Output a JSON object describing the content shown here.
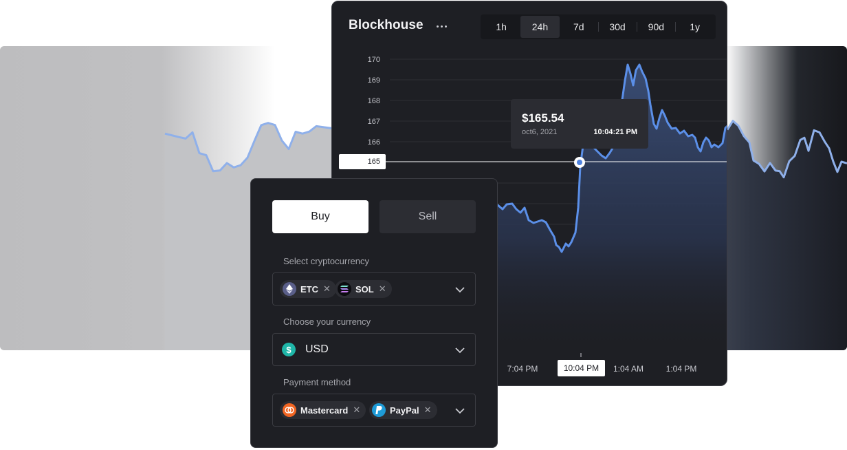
{
  "chart": {
    "title": "Blockhouse",
    "ranges": [
      {
        "label": "1h",
        "active": false
      },
      {
        "label": "24h",
        "active": true
      },
      {
        "label": "7d",
        "active": false
      },
      {
        "label": "30d",
        "active": false
      },
      {
        "label": "90d",
        "active": false
      },
      {
        "label": "1y",
        "active": false
      }
    ],
    "y_ticks": [
      "170",
      "169",
      "168",
      "167",
      "166",
      "165"
    ],
    "x_ticks": [
      "7:04 PM",
      "10:04 PM",
      "1:04 AM",
      "1:04 PM"
    ],
    "hover_price_label": "165",
    "hover_time_label": "10:04 PM",
    "line_color": "#5b8fe8",
    "tooltip": {
      "price": "$165.54",
      "date": "oct6, 2021",
      "time": "10:04:21 PM"
    }
  },
  "trade": {
    "buy_label": "Buy",
    "sell_label": "Sell",
    "selected_side": "Buy",
    "crypto": {
      "label": "Select cryptocurrency",
      "selected": [
        {
          "symbol": "ETC",
          "icon": "ethereum-icon"
        },
        {
          "symbol": "SOL",
          "icon": "solana-icon"
        }
      ]
    },
    "currency": {
      "label": "Choose your currency",
      "value": "USD",
      "icon": "dollar-icon"
    },
    "payment": {
      "label": "Payment method",
      "selected": [
        {
          "name": "Mastercard",
          "icon": "mastercard-icon"
        },
        {
          "name": "PayPal",
          "icon": "paypal-icon"
        }
      ]
    }
  },
  "colors": {
    "card_bg": "#1e1f24",
    "accent_blue": "#5b8fe8",
    "usd_teal": "#1fb6a8",
    "mastercard_orange": "#f26522",
    "paypal_blue": "#1e9bd7"
  }
}
